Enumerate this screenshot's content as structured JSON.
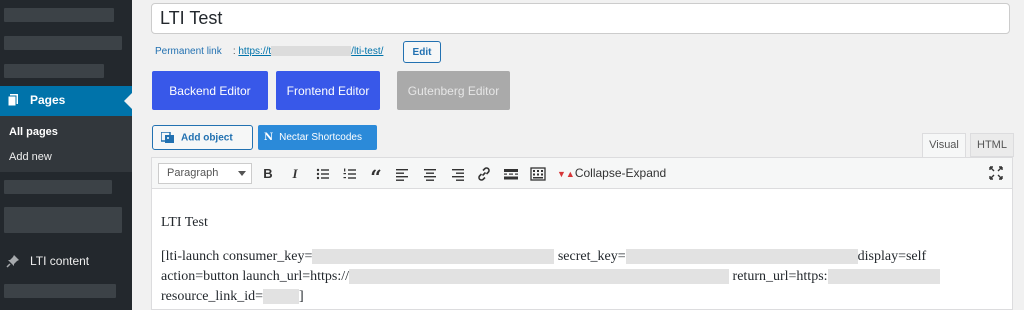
{
  "sidebar": {
    "pages_label": "Pages",
    "submenu": [
      "All pages",
      "Add new"
    ],
    "lti_label": "LTI content"
  },
  "post": {
    "title": "LTI Test",
    "permalink_label": "Permanent link",
    "permalink_prefix": "https://t",
    "permalink_suffix": "/lti-test/",
    "edit_label": "Edit"
  },
  "editor_switch": {
    "backend": "Backend Editor",
    "frontend": "Frontend Editor",
    "gutenberg": "Gutenberg Editor"
  },
  "media": {
    "add_object": "Add object",
    "nectar_letter": "N",
    "nectar": "Nectar Shortcodes"
  },
  "tabs": {
    "visual": "Visual",
    "html": "HTML"
  },
  "toolbar": {
    "format": "Paragraph",
    "bold": "B",
    "italic": "I",
    "quote": "“",
    "collapse_expand": "Collapse-Expand"
  },
  "content": {
    "heading": "LTI Test",
    "line1_a": "[lti-launch consumer_key=",
    "line1_b": "secret_key=",
    "line1_c": "display=self",
    "line2_a": "action=button launch_url=https://",
    "line2_b": "return_url=https:",
    "line3_a": "resource_link_id=",
    "line3_b": "]"
  },
  "colors": {
    "sidebar_bg": "#23282d",
    "sidebar_active": "#0073aa",
    "editor_button": "#3858e9",
    "gutenberg_button": "#aaaaaa",
    "nectar_button": "#2b8ad9"
  }
}
